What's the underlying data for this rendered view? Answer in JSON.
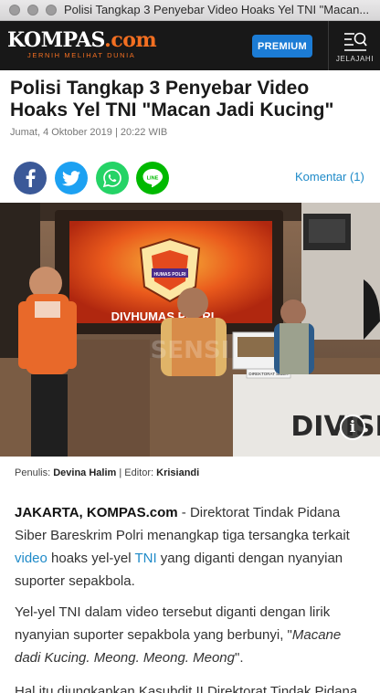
{
  "window": {
    "title": "Polisi Tangkap 3 Penyebar Video Hoaks Yel TNI \"Macan..."
  },
  "header": {
    "logo_text": "KOMPAS",
    "logo_suffix": ".com",
    "tagline": "JERNIH MELIHAT DUNIA",
    "premium_label": "PREMIUM",
    "jelajahi_label": "JELAJAHI"
  },
  "article": {
    "headline": "Polisi Tangkap 3 Penyebar Video Hoaks Yel TNI \"Macan Jadi Kucing\"",
    "date": "Jumat, 4 Oktober 2019 | 20:22 WIB",
    "komentar_label": "Komentar (1)",
    "byline": {
      "penulis_label": "Penulis:",
      "penulis": "Devina Halim",
      "separator": "|",
      "editor_label": "Editor:",
      "editor": "Krisiandi"
    },
    "p1": {
      "lead": "JAKARTA, KOMPAS.com",
      "t1": " - Direktorat Tindak Pidana Siber Bareskrim Polri menangkap tiga tersangka terkait ",
      "link1": "video",
      "t2": " hoaks yel-yel ",
      "link2": "TNI",
      "t3": " yang diganti dengan nyanyian suporter sepakbola."
    },
    "p2": {
      "t1": "Yel-yel TNI dalam video tersebut diganti dengan lirik nyanyian suporter sepakbola yang berbunyi, \"",
      "quote": "Macane dadi Kucing. Meong. Meong. Meong",
      "t2": "\"."
    },
    "p3": {
      "text": "Hal itu diungkapkan Kasubdit II Direktorat Tindak Pidana Siber"
    }
  },
  "photo": {
    "banner_text": "DIVHUMAS POLRI",
    "emblem_text": "HUMAS POLRI",
    "nameplate_text": "DIREKTORAT SIBER",
    "podium_text": "DIVISI",
    "watermark_text": "SENSI"
  },
  "icons": [
    "close-dot-icon",
    "minimize-dot-icon",
    "zoom-dot-icon",
    "jelajahi-menu-icon",
    "facebook-icon",
    "twitter-icon",
    "whatsapp-icon",
    "line-icon",
    "info-icon"
  ],
  "colors": {
    "header_bg": "#181818",
    "brand_orange": "#f36f21",
    "premium_blue": "#1c7cd5",
    "link_blue": "#1e8ac8",
    "facebook": "#3b5998",
    "twitter": "#1da1f2",
    "whatsapp": "#25d366",
    "line": "#00b900"
  }
}
